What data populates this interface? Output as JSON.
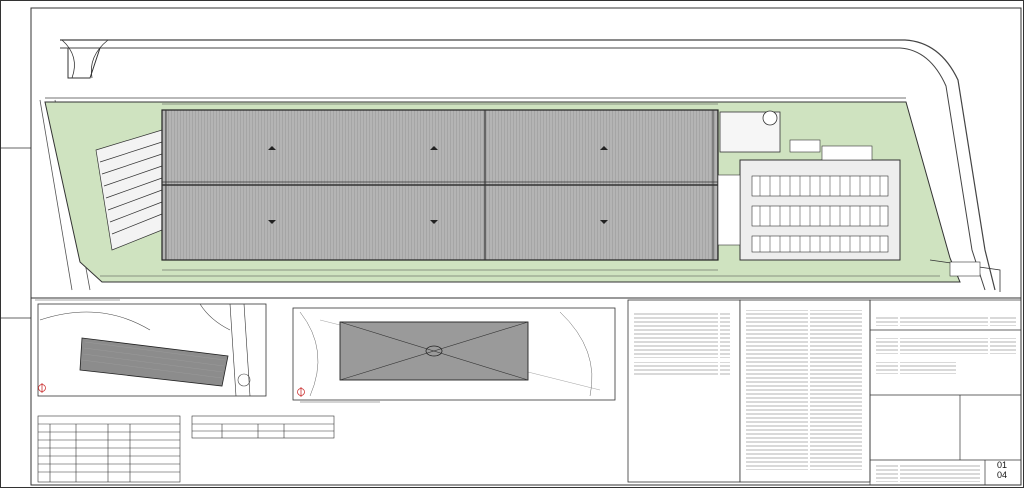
{
  "drawing": {
    "sheet_number": "01",
    "sheet_total": "04"
  },
  "colors": {
    "paper": "#ffffff",
    "line": "#222222",
    "grass": "#cfe3c0",
    "roof": "#a9a9a9",
    "roof_dark": "#8c8c8c",
    "paving": "#eeeeee"
  }
}
